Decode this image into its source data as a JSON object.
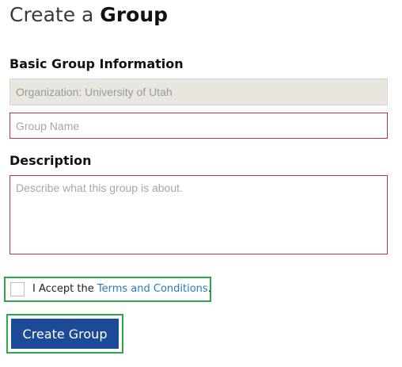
{
  "page": {
    "title_prefix": "Create a ",
    "title_strong": "Group"
  },
  "basic_info": {
    "heading": "Basic Group Information",
    "organization_value": "Organization: University of Utah",
    "group_name_placeholder": "Group Name"
  },
  "description": {
    "heading": "Description",
    "placeholder": "Describe what this group is about."
  },
  "terms": {
    "accept_prefix": "I Accept the ",
    "link_label": "Terms and Conditions",
    "accept_suffix": "."
  },
  "actions": {
    "create_label": "Create Group"
  },
  "colors": {
    "accent_green": "#2aa84a",
    "button_blue": "#1c4a96",
    "error_red": "#c8323c",
    "link_blue": "#2b7ab8"
  }
}
